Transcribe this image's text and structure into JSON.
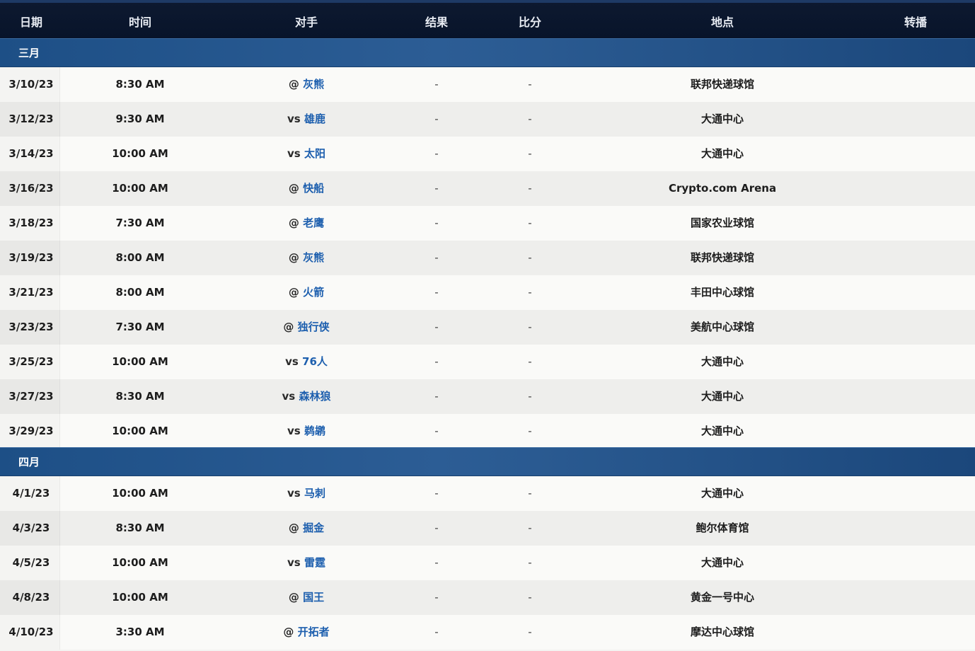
{
  "headers": [
    "日期",
    "时间",
    "对手",
    "结果",
    "比分",
    "地点",
    "转播"
  ],
  "months": [
    {
      "label": "三月",
      "games": [
        {
          "date": "3/10/23",
          "time": "8:30 AM",
          "prefix": "@",
          "team": "灰熊",
          "result": "-",
          "score": "-",
          "venue": "联邦快递球馆"
        },
        {
          "date": "3/12/23",
          "time": "9:30 AM",
          "prefix": "vs",
          "team": "雄鹿",
          "result": "-",
          "score": "-",
          "venue": "大通中心"
        },
        {
          "date": "3/14/23",
          "time": "10:00 AM",
          "prefix": "vs",
          "team": "太阳",
          "result": "-",
          "score": "-",
          "venue": "大通中心"
        },
        {
          "date": "3/16/23",
          "time": "10:00 AM",
          "prefix": "@",
          "team": "快船",
          "result": "-",
          "score": "-",
          "venue": "Crypto.com Arena"
        },
        {
          "date": "3/18/23",
          "time": "7:30 AM",
          "prefix": "@",
          "team": "老鹰",
          "result": "-",
          "score": "-",
          "venue": "国家农业球馆"
        },
        {
          "date": "3/19/23",
          "time": "8:00 AM",
          "prefix": "@",
          "team": "灰熊",
          "result": "-",
          "score": "-",
          "venue": "联邦快递球馆"
        },
        {
          "date": "3/21/23",
          "time": "8:00 AM",
          "prefix": "@",
          "team": "火箭",
          "result": "-",
          "score": "-",
          "venue": "丰田中心球馆"
        },
        {
          "date": "3/23/23",
          "time": "7:30 AM",
          "prefix": "@",
          "team": "独行侠",
          "result": "-",
          "score": "-",
          "venue": "美航中心球馆"
        },
        {
          "date": "3/25/23",
          "time": "10:00 AM",
          "prefix": "vs",
          "team": "76人",
          "result": "-",
          "score": "-",
          "venue": "大通中心"
        },
        {
          "date": "3/27/23",
          "time": "8:30 AM",
          "prefix": "vs",
          "team": "森林狼",
          "result": "-",
          "score": "-",
          "venue": "大通中心"
        },
        {
          "date": "3/29/23",
          "time": "10:00 AM",
          "prefix": "vs",
          "team": "鹈鹕",
          "result": "-",
          "score": "-",
          "venue": "大通中心"
        }
      ]
    },
    {
      "label": "四月",
      "games": [
        {
          "date": "4/1/23",
          "time": "10:00 AM",
          "prefix": "vs",
          "team": "马刺",
          "result": "-",
          "score": "-",
          "venue": "大通中心"
        },
        {
          "date": "4/3/23",
          "time": "8:30 AM",
          "prefix": "@",
          "team": "掘金",
          "result": "-",
          "score": "-",
          "venue": "鲍尔体育馆"
        },
        {
          "date": "4/5/23",
          "time": "10:00 AM",
          "prefix": "vs",
          "team": "雷霆",
          "result": "-",
          "score": "-",
          "venue": "大通中心"
        },
        {
          "date": "4/8/23",
          "time": "10:00 AM",
          "prefix": "@",
          "team": "国王",
          "result": "-",
          "score": "-",
          "venue": "黄金一号中心"
        },
        {
          "date": "4/10/23",
          "time": "3:30 AM",
          "prefix": "@",
          "team": "开拓者",
          "result": "-",
          "score": "-",
          "venue": "摩达中心球馆"
        }
      ]
    }
  ],
  "colors": {
    "header_bg": "#0b1730",
    "month_bar": "#2a5a91",
    "team_link": "#1d5fae"
  }
}
